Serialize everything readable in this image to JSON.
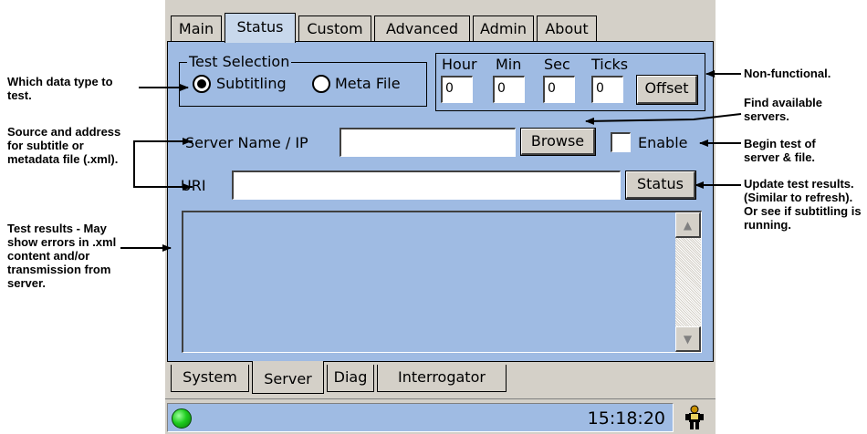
{
  "annotations": {
    "data_type": "Which data type to test.",
    "source": "Source and address for subtitle or metadata file (.xml).",
    "results": "Test results - May show errors in .xml content and/or transmission from server.",
    "non_functional": "Non-functional.",
    "find_servers": "Find available servers.",
    "begin_test": "Begin test of server & file.",
    "update": "Update test results. (Similar to refresh). Or see if subtitling is running."
  },
  "top_tabs": [
    "Main",
    "Status",
    "Custom",
    "Advanced",
    "Admin",
    "About"
  ],
  "active_top_tab": "Status",
  "test_selection": {
    "legend": "Test Selection",
    "options": [
      "Subtitling",
      "Meta File"
    ],
    "selected": "Subtitling"
  },
  "offset": {
    "labels": [
      "Hour",
      "Min",
      "Sec",
      "Ticks"
    ],
    "values": [
      "0",
      "0",
      "0",
      "0"
    ],
    "button": "Offset"
  },
  "server": {
    "label": "Server Name / IP",
    "value": "",
    "browse_button": "Browse",
    "enable_label": "Enable",
    "enable_checked": false
  },
  "uri": {
    "label": "URI",
    "value": "",
    "status_button": "Status"
  },
  "results_text": "",
  "bottom_tabs": [
    "System",
    "Server",
    "Diag",
    "Interrogator"
  ],
  "active_bottom_tab": "Server",
  "status_bar": {
    "time": "15:18:20",
    "led_color": "#1ecc1e"
  },
  "colors": {
    "panel_bg": "#9fbbe3",
    "chrome": "#d4d0c8"
  }
}
